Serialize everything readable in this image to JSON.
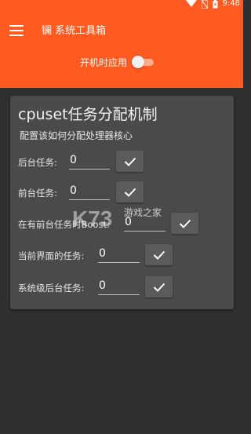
{
  "status_bar": {
    "time": "9:48",
    "icons": [
      "wifi-icon",
      "no-sim-icon",
      "battery-charging-icon"
    ]
  },
  "app_bar": {
    "menu_icon": "menu-icon",
    "title": "镧 系统工具箱",
    "autostart_label": "开机时应用",
    "autostart_enabled": false
  },
  "card": {
    "title": "cpuset任务分配机制",
    "subtitle": "配置该如何分配处理器核心",
    "rows": [
      {
        "label": "后台任务:",
        "value": "0",
        "button_icon": "check-icon"
      },
      {
        "label": "前台任务:",
        "value": "0",
        "button_icon": "check-icon"
      },
      {
        "label": "在有前台任务时Boost:",
        "value": "0",
        "button_icon": "check-icon"
      },
      {
        "label": "当前界面的任务:",
        "value": "0",
        "button_icon": "check-icon"
      },
      {
        "label": "系统级后台任务:",
        "value": "0",
        "button_icon": "check-icon"
      }
    ]
  },
  "watermark": {
    "logo_text": "K73",
    "site_text": "游戏之家"
  },
  "colors": {
    "accent": "#ff5a1f",
    "background": "#2f2f2f",
    "card": "#4a4a4a",
    "button": "#5b5b5b"
  }
}
